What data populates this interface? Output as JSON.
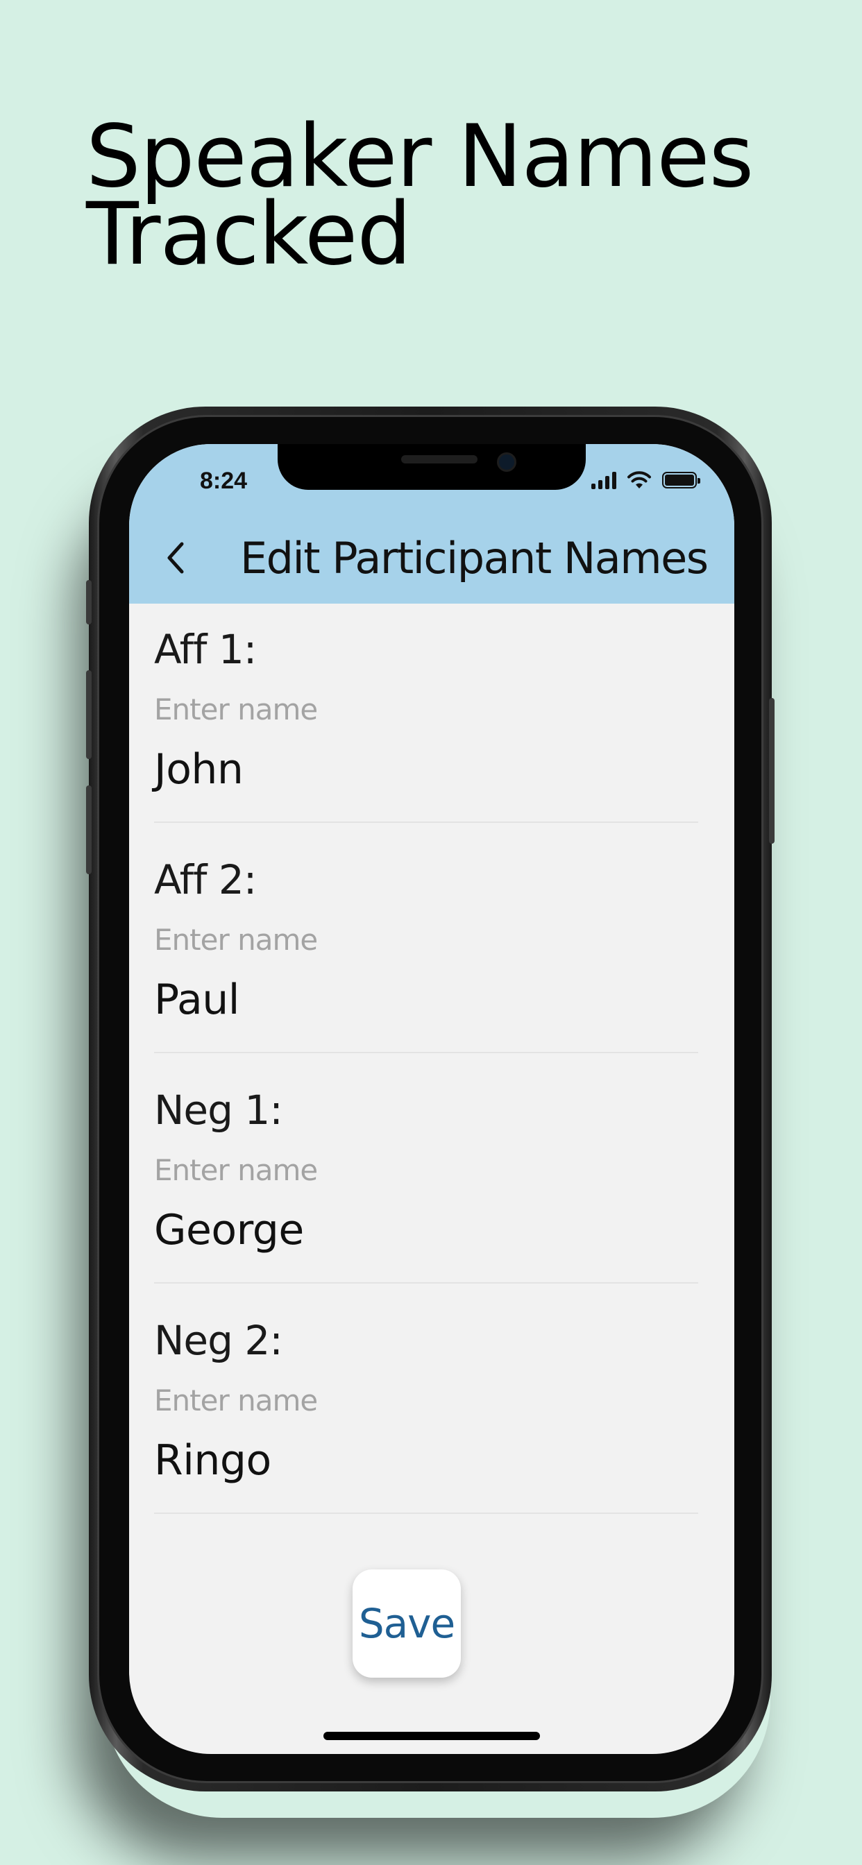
{
  "marketing": {
    "headline_line1": "Speaker Names",
    "headline_line2": "Tracked",
    "background_color": "#d5f0e4"
  },
  "status_bar": {
    "time": "8:24",
    "icons": [
      "cellular-signal-icon",
      "wifi-icon",
      "battery-icon"
    ]
  },
  "header": {
    "back_icon": "chevron-left-icon",
    "title": "Edit Participant Names",
    "background_color": "#a6d2ea"
  },
  "fields": [
    {
      "label": "Aff 1:",
      "placeholder": "Enter name",
      "value": "John"
    },
    {
      "label": "Aff 2:",
      "placeholder": "Enter name",
      "value": "Paul"
    },
    {
      "label": "Neg 1:",
      "placeholder": "Enter name",
      "value": "George"
    },
    {
      "label": "Neg 2:",
      "placeholder": "Enter name",
      "value": "Ringo"
    }
  ],
  "save_button": {
    "label": "Save",
    "text_color": "#1f5f93"
  }
}
